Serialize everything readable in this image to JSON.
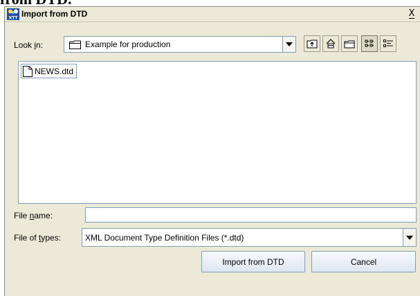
{
  "doc_fragment": "from DTD.",
  "window": {
    "title": "Import from DTD",
    "icon_name": "xtt-app-icon",
    "close_glyph": "X"
  },
  "look_in": {
    "label_prefix": "Look ",
    "label_mnemonic": "i",
    "label_suffix": "n:",
    "value": "Example for production",
    "icon": "folder-icon"
  },
  "toolbar": {
    "buttons": [
      {
        "name": "up-one-level",
        "icon": "up-folder-icon"
      },
      {
        "name": "home",
        "icon": "home-icon"
      },
      {
        "name": "new-folder",
        "icon": "new-folder-icon"
      },
      {
        "name": "list-view",
        "icon": "list-view-icon",
        "pressed": true
      },
      {
        "name": "details-view",
        "icon": "details-view-icon",
        "pressed": false
      }
    ]
  },
  "files": [
    {
      "name": "NEWS.dtd",
      "icon": "document-icon"
    }
  ],
  "file_name": {
    "label_prefix": "File ",
    "label_mnemonic": "n",
    "label_suffix": "ame:",
    "value": ""
  },
  "file_types": {
    "label_prefix": "File of ",
    "label_mnemonic": "t",
    "label_suffix": "ypes:",
    "value": "XML Document Type Definition Files (*.dtd)"
  },
  "actions": {
    "import_label": "Import from DTD",
    "cancel_label": "Cancel"
  },
  "colors": {
    "dialog_bg": "#ece9d8",
    "field_border": "#7f9db9",
    "field_bg": "#ffffff"
  }
}
